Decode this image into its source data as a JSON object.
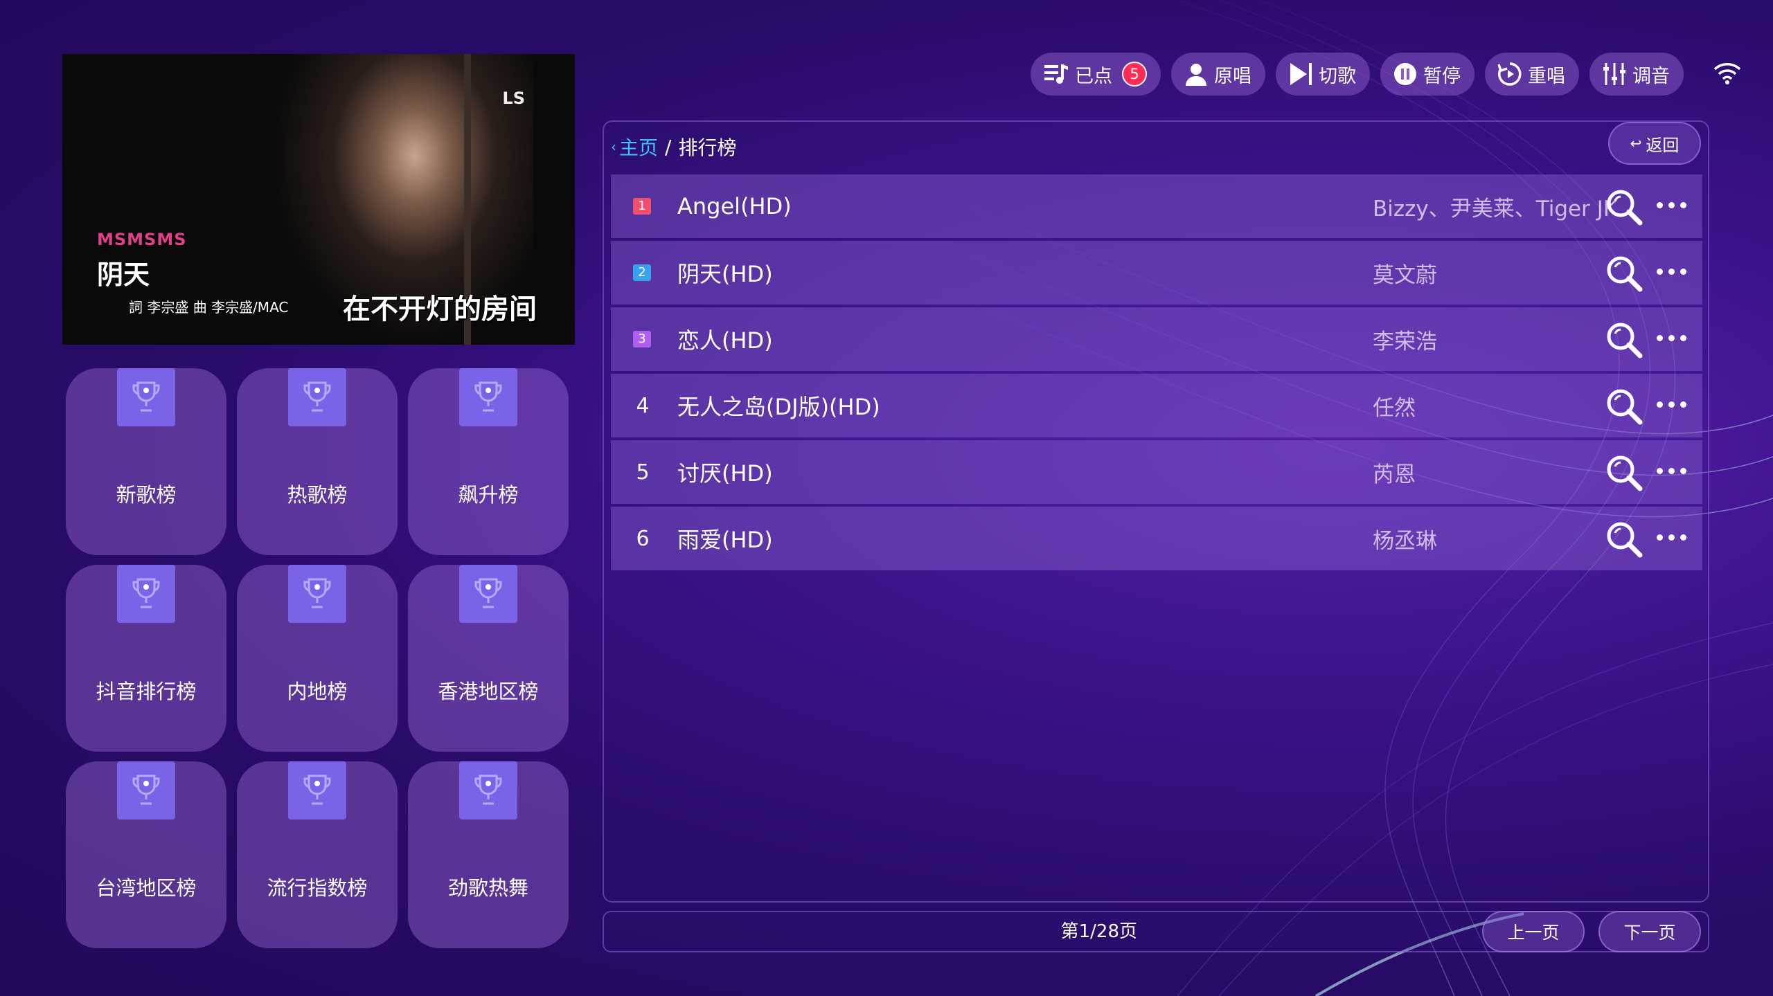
{
  "video": {
    "logo": "LS",
    "brand": "MSMSMS",
    "song_title": "阴天",
    "credits": "詞 李宗盛   曲 李宗盛/MAC",
    "lyric": "在不开灯的房间"
  },
  "categories": [
    {
      "label": "新歌榜"
    },
    {
      "label": "热歌榜"
    },
    {
      "label": "飙升榜"
    },
    {
      "label": "抖音排行榜"
    },
    {
      "label": "内地榜"
    },
    {
      "label": "香港地区榜"
    },
    {
      "label": "台湾地区榜"
    },
    {
      "label": "流行指数榜"
    },
    {
      "label": "劲歌热舞"
    }
  ],
  "toolbar": {
    "queued_label": "已点",
    "queued_count": "5",
    "original_label": "原唱",
    "skip_label": "切歌",
    "pause_label": "暂停",
    "replay_label": "重唱",
    "tune_label": "调音"
  },
  "breadcrumb": {
    "home": "主页",
    "separator": "/",
    "current": "排行榜"
  },
  "back_label": "返回",
  "songs": [
    {
      "rank": "1",
      "title": "Angel(HD)",
      "artist": "Bizzy、尹美莱、Tiger JK",
      "rank_color": "#f0506e"
    },
    {
      "rank": "2",
      "title": "阴天(HD)",
      "artist": "莫文蔚",
      "rank_color": "#3aa0f0"
    },
    {
      "rank": "3",
      "title": "恋人(HD)",
      "artist": "李荣浩",
      "rank_color": "#b060f0"
    },
    {
      "rank": "4",
      "title": "无人之岛(DJ版)(HD)",
      "artist": "任然"
    },
    {
      "rank": "5",
      "title": "讨厌(HD)",
      "artist": "芮恩"
    },
    {
      "rank": "6",
      "title": "雨爱(HD)",
      "artist": "杨丞琳"
    }
  ],
  "pagination": {
    "info": "第1/28页",
    "prev_label": "上一页",
    "next_label": "下一页"
  },
  "colors": {
    "breadcrumb_home": "#39c6ff",
    "badge": "#ff2d55",
    "tile_badge": "#7b63e8"
  }
}
